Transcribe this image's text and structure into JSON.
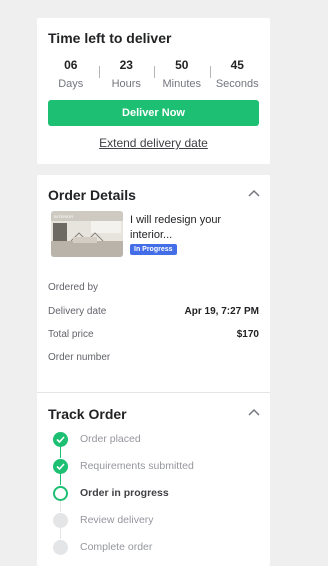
{
  "countdown": {
    "title": "Time left to deliver",
    "units": [
      {
        "value": "06",
        "label": "Days"
      },
      {
        "value": "23",
        "label": "Hours"
      },
      {
        "value": "50",
        "label": "Minutes"
      },
      {
        "value": "45",
        "label": "Seconds"
      }
    ],
    "deliver_label": "Deliver Now",
    "extend_label": "Extend delivery date"
  },
  "order_details": {
    "title": "Order Details",
    "gig_title": "I will redesign your interior...",
    "status_badge": "In Progress",
    "rows": [
      {
        "label": "Ordered by",
        "value": ""
      },
      {
        "label": "Delivery date",
        "value": "Apr 19, 7:27 PM"
      },
      {
        "label": "Total price",
        "value": "$170"
      },
      {
        "label": "Order number",
        "value": ""
      }
    ]
  },
  "track_order": {
    "title": "Track Order",
    "steps": [
      {
        "label": "Order placed",
        "status": "done"
      },
      {
        "label": "Requirements submitted",
        "status": "done"
      },
      {
        "label": "Order in progress",
        "status": "current"
      },
      {
        "label": "Review delivery",
        "status": "todo"
      },
      {
        "label": "Complete order",
        "status": "todo"
      }
    ]
  },
  "colors": {
    "accent": "#1dbf73",
    "badge": "#446ee7",
    "background": "#efefef"
  },
  "icons": {
    "collapse": "chevron-up-icon",
    "check": "check-icon"
  }
}
